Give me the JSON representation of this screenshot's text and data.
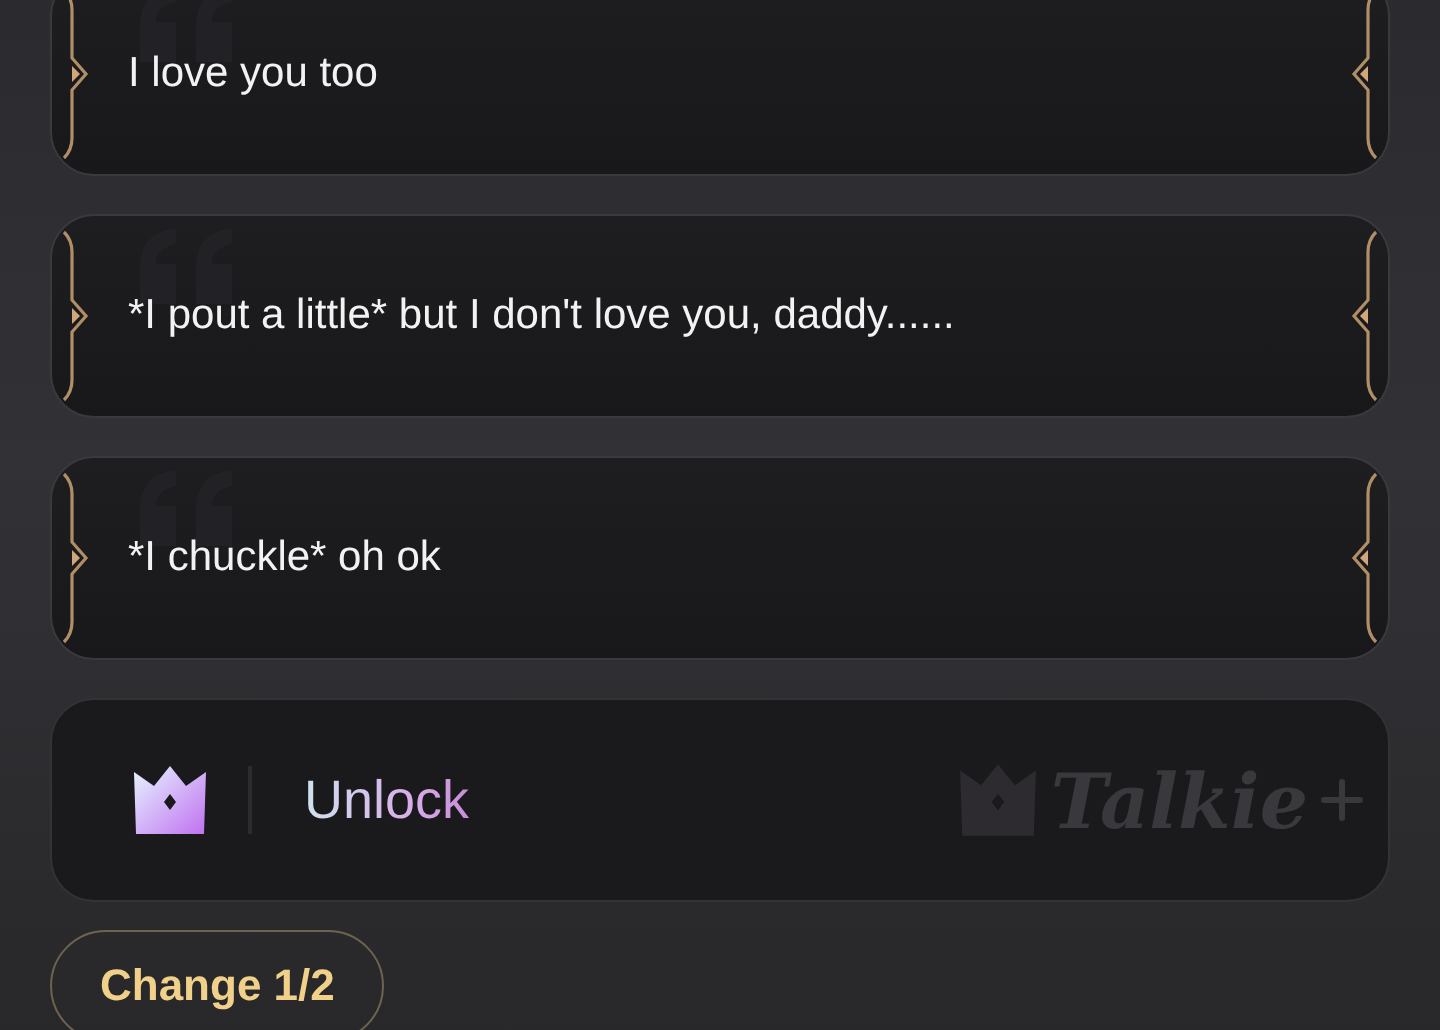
{
  "replies": [
    {
      "text": "I love you too"
    },
    {
      "text": "*I pout a little* but I don't love you, daddy......"
    },
    {
      "text": "*I chuckle* oh ok"
    }
  ],
  "unlock": {
    "label": "Unlock",
    "logo_text": "Talkie"
  },
  "change_button": {
    "label": "Change 1/2"
  }
}
